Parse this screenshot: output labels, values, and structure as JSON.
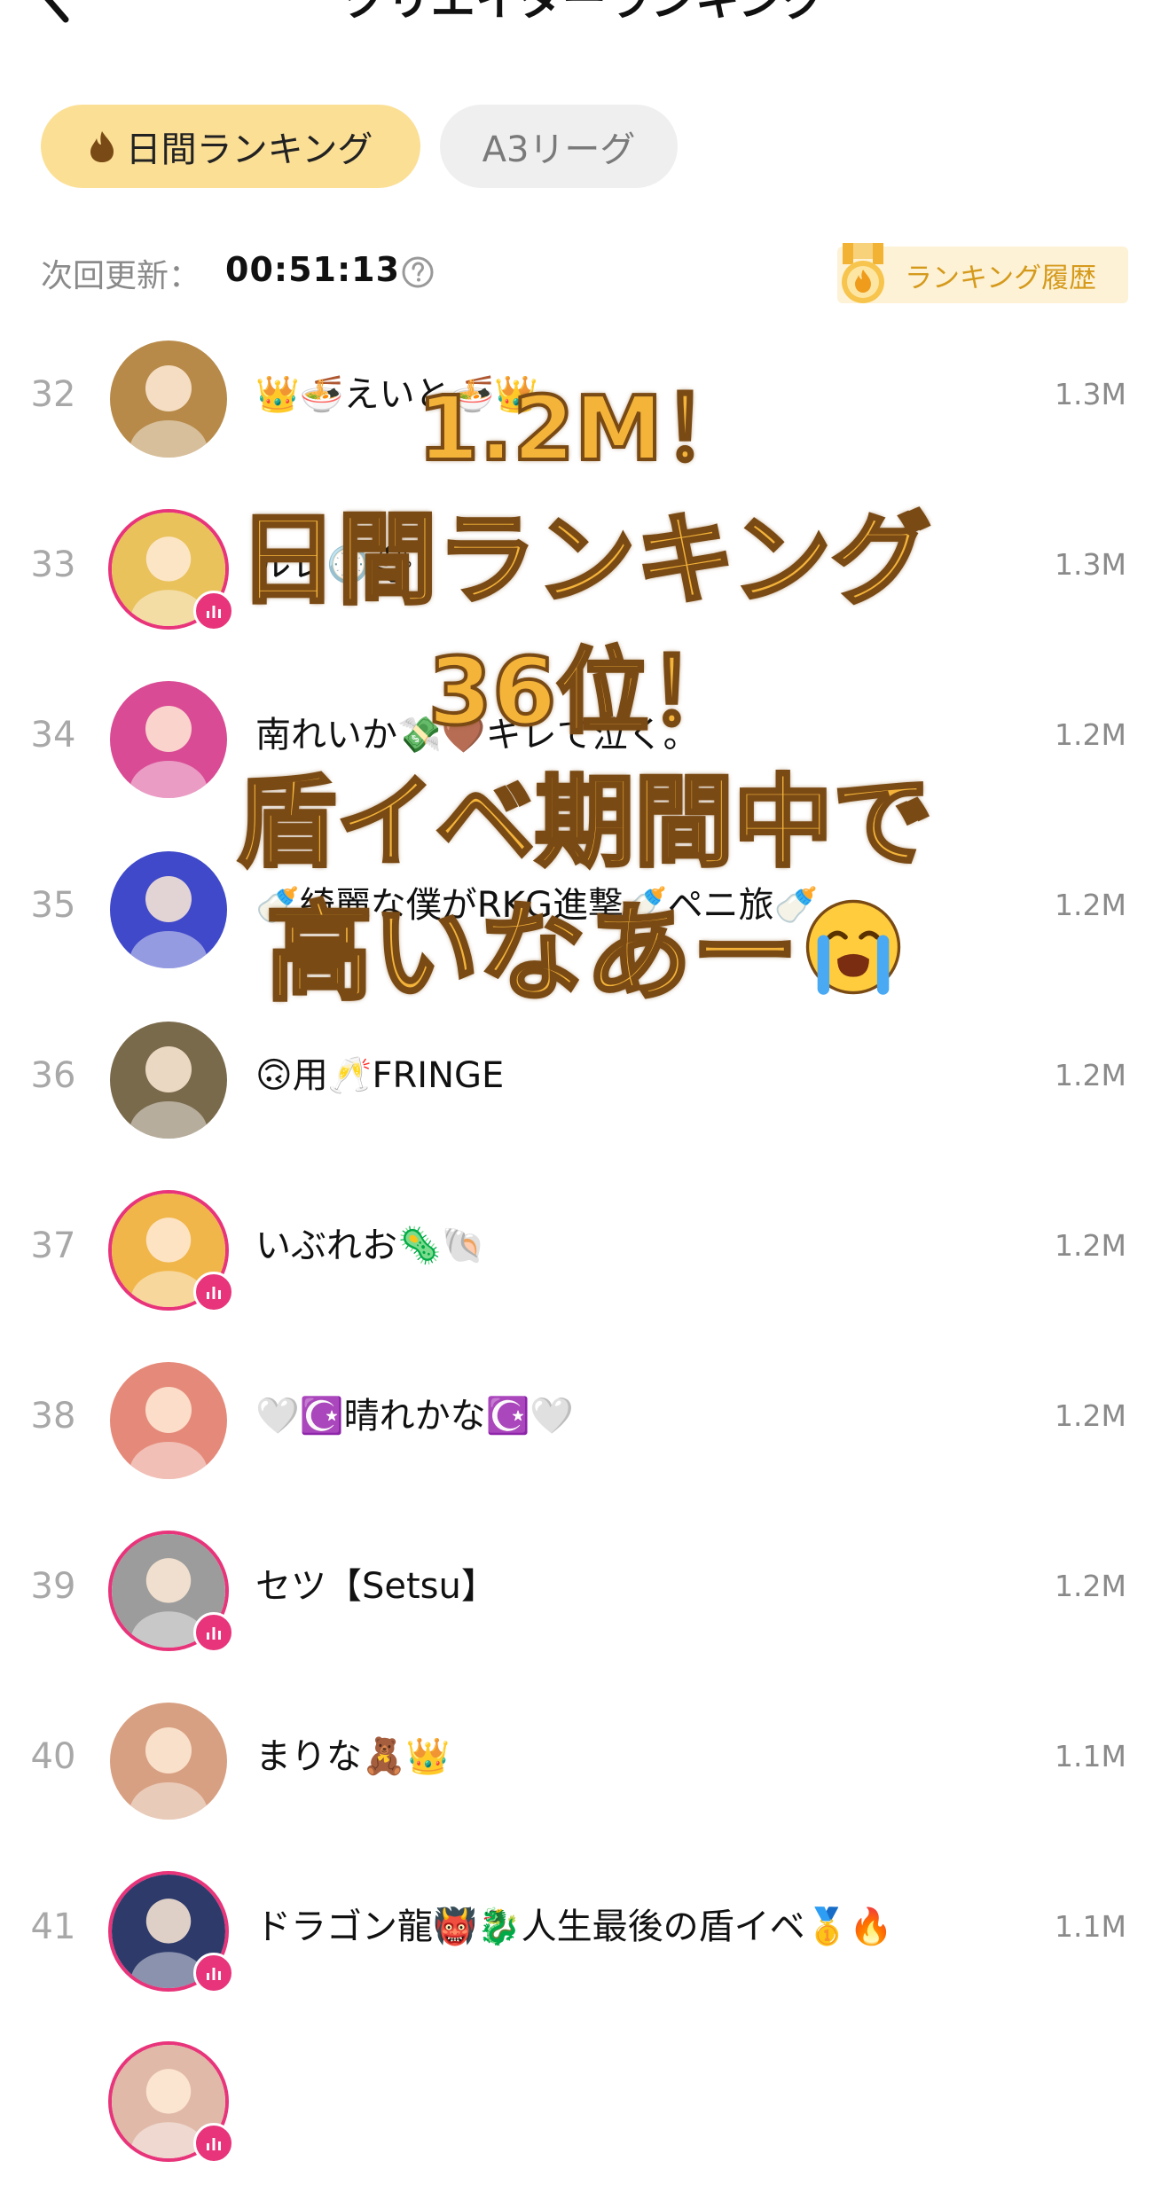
{
  "header": {
    "title": "クリエイターランキング"
  },
  "tabs": {
    "daily": "日間ランキング",
    "league": "A3リーグ"
  },
  "update": {
    "label": "次回更新：",
    "time": "00:51:13"
  },
  "history": {
    "label": "ランキング履歴"
  },
  "rows": [
    {
      "rank": "32",
      "name": "👑🍜えいと🍜👑",
      "score": "1.3M",
      "live": false,
      "color": "#b78a4a"
    },
    {
      "rank": "33",
      "name": "ルレ🕐⛑",
      "score": "1.3M",
      "live": true,
      "color": "#e9c25c"
    },
    {
      "rank": "34",
      "name": "南れいか💸🤎キレて泣く。",
      "score": "1.2M",
      "live": false,
      "color": "#d94b94"
    },
    {
      "rank": "35",
      "name": "🍼綺麗な僕がRKG進撃🍼ペニ旅🍼",
      "score": "1.2M",
      "live": false,
      "color": "#3f49c9"
    },
    {
      "rank": "36",
      "name": "🙃用🥂FRINGE",
      "score": "1.2M",
      "live": false,
      "color": "#7a6a4c"
    },
    {
      "rank": "37",
      "name": "いぶれお🦠🐚",
      "score": "1.2M",
      "live": true,
      "color": "#f1b64a"
    },
    {
      "rank": "38",
      "name": "🤍☪️晴れかな☪️🤍",
      "score": "1.2M",
      "live": false,
      "color": "#e58a7a"
    },
    {
      "rank": "39",
      "name": "セツ【Setsu】",
      "score": "1.2M",
      "live": true,
      "color": "#9c9c9c"
    },
    {
      "rank": "40",
      "name": "まりな🧸👑",
      "score": "1.1M",
      "live": false,
      "color": "#d8a082"
    },
    {
      "rank": "41",
      "name": "ドラゴン龍👹🐉人生最後の盾イベ🥇🔥",
      "score": "1.1M",
      "live": true,
      "color": "#2d3a6a"
    },
    {
      "rank": "",
      "name": "",
      "score": "",
      "live": true,
      "color": "#e0b9a8"
    }
  ],
  "overlay": {
    "line1": "1.2M！",
    "line2": "日間ランキング",
    "line3": "36位！",
    "line4": "盾イベ期間中で",
    "line5": "高いなあー"
  }
}
